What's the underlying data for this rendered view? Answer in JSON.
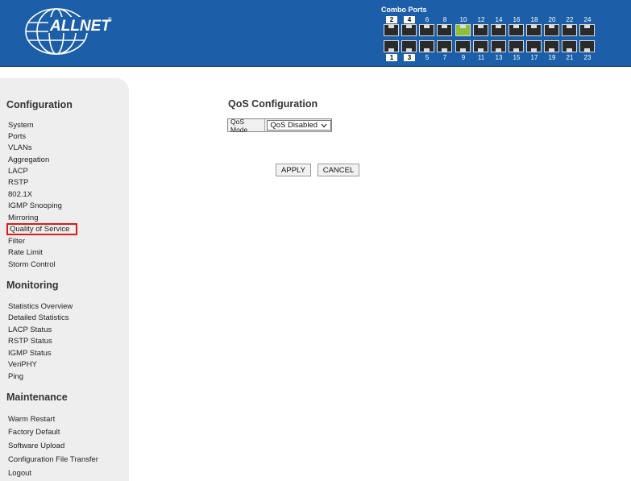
{
  "header": {
    "logo_text": "ALLNET",
    "ports_title": "Combo Ports",
    "top_ports": [
      "2",
      "4",
      "6",
      "8",
      "10",
      "12",
      "14",
      "16",
      "18",
      "20",
      "22",
      "24"
    ],
    "bottom_ports": [
      "1",
      "3",
      "5",
      "7",
      "9",
      "11",
      "13",
      "15",
      "17",
      "19",
      "21",
      "23"
    ],
    "active_port": "10",
    "colors": {
      "banner": "#1c5fa8",
      "port_active": "#8fbf3a",
      "port_inactive": "#2a2a2a"
    }
  },
  "sidebar": {
    "sections": [
      {
        "title": "Configuration",
        "items": [
          "System",
          "Ports",
          "VLANs",
          "Aggregation",
          "LACP",
          "RSTP",
          "802.1X",
          "IGMP Snooping",
          "Mirroring",
          "Quality of Service",
          "Filter",
          "Rate Limit",
          "Storm Control"
        ]
      },
      {
        "title": "Monitoring",
        "items": [
          "Statistics Overview",
          "Detailed Statistics",
          "LACP Status",
          "RSTP Status",
          "IGMP Status",
          "VeriPHY",
          "Ping"
        ]
      },
      {
        "title": "Maintenance",
        "items": [
          "Warm Restart",
          "Factory Default",
          "Software Upload",
          "Configuration File Transfer",
          "Logout"
        ]
      }
    ],
    "selected_item": "Quality of Service",
    "colors": {
      "selected_border": "#e01a1a"
    }
  },
  "main": {
    "title": "QoS Configuration",
    "qos_mode_label": "QoS Mode",
    "qos_mode_value": "QoS Disabled",
    "apply_label": "APPLY",
    "cancel_label": "CANCEL"
  }
}
